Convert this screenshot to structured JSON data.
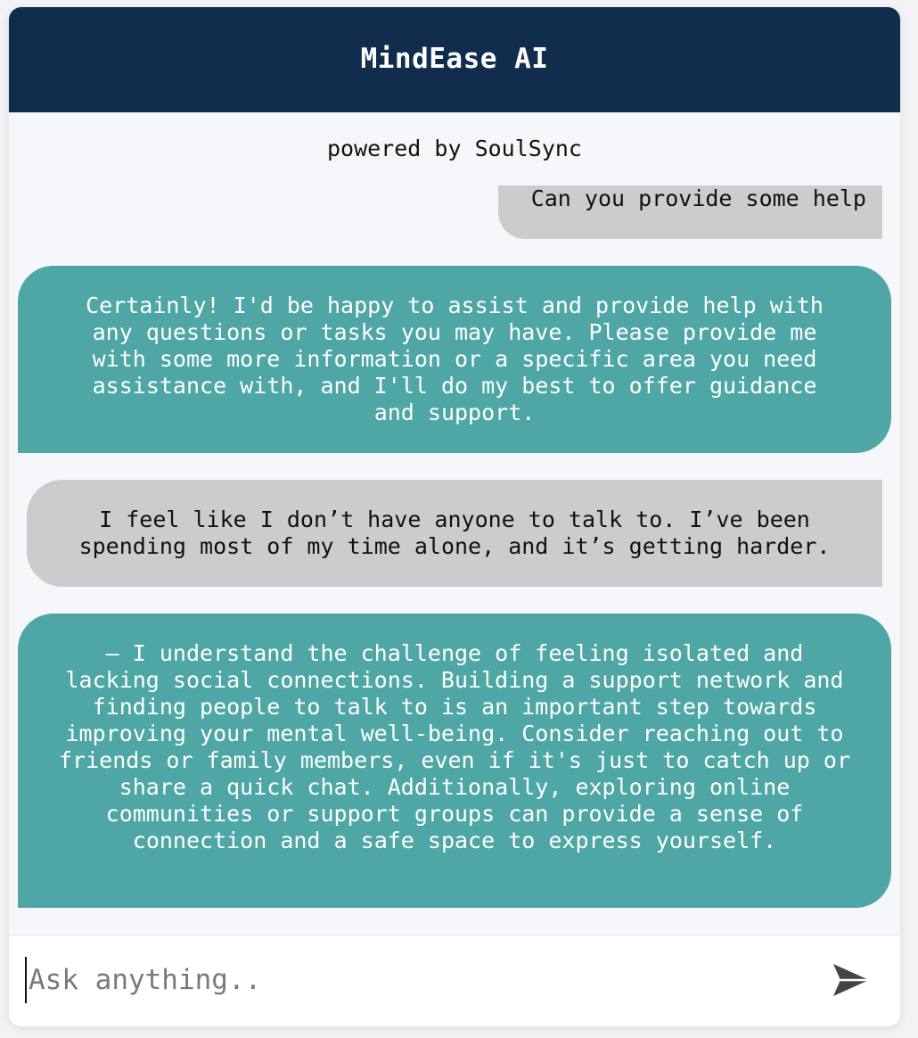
{
  "app": {
    "title": "MindEase AI",
    "subtitle": "powered by SoulSync"
  },
  "messages": [
    {
      "role": "user",
      "text": "Can you provide some help"
    },
    {
      "role": "assistant",
      "text": "Certainly! I'd be happy to assist and provide help with any questions or tasks you may have. Please provide me with some more information or a specific area you need assistance with, and I'll do my best to offer guidance and support."
    },
    {
      "role": "user",
      "text": "I feel like I don’t have anyone to talk to. I’ve been spending most of my time alone, and it’s getting harder."
    },
    {
      "role": "assistant",
      "text": "– I understand the challenge of feeling isolated and lacking social connections. Building a support network and finding people to talk to is an important step towards improving your mental well-being. Consider reaching out to friends or family members, even if it's just to catch up or share a quick chat. Additionally, exploring online communities or support groups can provide a sense of connection and a safe space to express yourself."
    }
  ],
  "composer": {
    "placeholder": "Ask anything..",
    "value": "",
    "send_icon": "send-icon"
  },
  "colors": {
    "header": "#112d4e",
    "assistant_bubble": "#4ea7a5",
    "user_bubble": "#cccccc",
    "chat_background": "#f6f7fb"
  }
}
